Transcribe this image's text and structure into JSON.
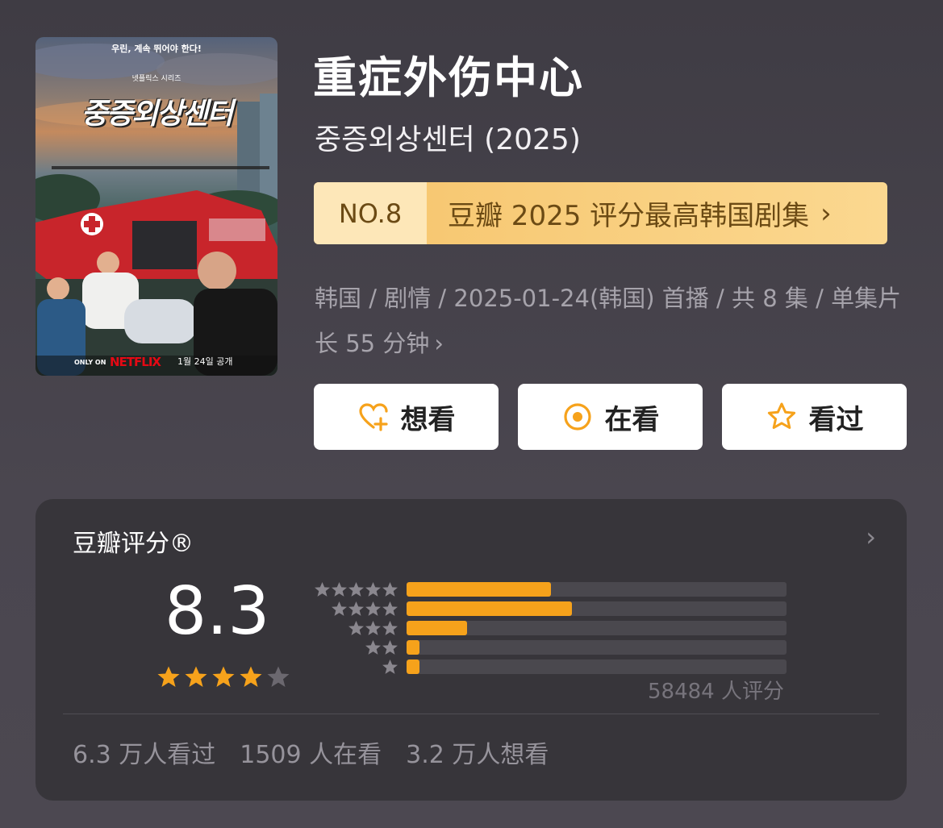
{
  "poster": {
    "tagline": "우린, 계속 뛰어야 한다!",
    "series_label": "넷플릭스 시리즈",
    "korean_title": "중증외상센터",
    "only_on": "ONLY ON",
    "platform": "NETFLIX",
    "release_note": "1월 24일 공개",
    "netflix_color": "#e50914"
  },
  "title": "重症外伤中心",
  "original_title": "중증외상센터 (2025)",
  "ranking": {
    "number": "NO.8",
    "label": "豆瓣 2025 评分最高韩国剧集",
    "chevron": "›"
  },
  "meta": {
    "text": "韩国 / 剧情 / 2025-01-24(韩国) 首播 / 共 8 集 / 单集片长 55 分钟",
    "chevron": "›"
  },
  "actions": [
    {
      "label": "想看",
      "icon": "heart-plus-icon"
    },
    {
      "label": "在看",
      "icon": "circle-dot-icon"
    },
    {
      "label": "看过",
      "icon": "star-outline-icon"
    }
  ],
  "rating": {
    "heading": "豆瓣评分®",
    "score": "8.3",
    "score_stars": 4,
    "chevron": "›",
    "distribution": [
      {
        "stars": 5,
        "fraction": 0.38
      },
      {
        "stars": 4,
        "fraction": 0.435
      },
      {
        "stars": 3,
        "fraction": 0.16
      },
      {
        "stars": 2,
        "fraction": 0.035
      },
      {
        "stars": 1,
        "fraction": 0.035
      }
    ],
    "count_text": "58484 人评分",
    "accent_color": "#f6a21b"
  },
  "stats": {
    "watched": "6.3 万人看过",
    "watching": "1509 人在看",
    "want": "3.2 万人想看"
  }
}
